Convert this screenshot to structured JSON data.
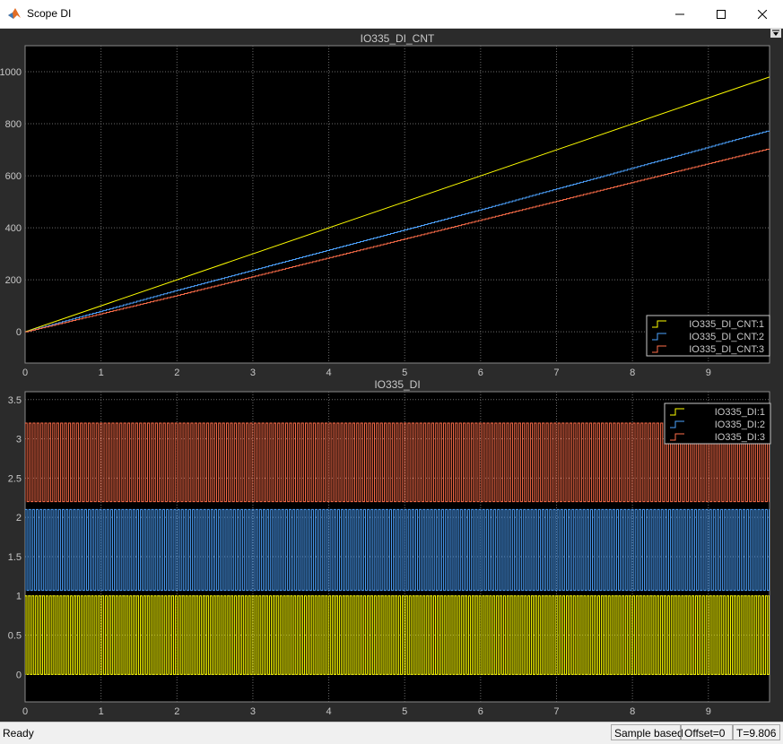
{
  "window": {
    "title": "Scope DI",
    "app_icon": "matlab-icon",
    "controls": [
      "minimize-icon",
      "maximize-icon",
      "close-icon"
    ]
  },
  "colors": {
    "scope_background": "#2b2b2b",
    "axes_background": "#000000",
    "grid": "#6a6a6a",
    "axis_text": "#c8c8c8",
    "series1": "#ffff00",
    "series2": "#4da3ff",
    "series3": "#ff6e4a"
  },
  "status": {
    "ready": "Ready",
    "mode": "Sample based",
    "offset": "Offset=0",
    "time": "T=9.806"
  },
  "chart_data": [
    {
      "type": "line",
      "title": "IO335_DI_CNT",
      "xlabel": "",
      "ylabel": "",
      "xlim": [
        0,
        9.806
      ],
      "ylim": [
        -120,
        1100
      ],
      "xticks": [
        0,
        1,
        2,
        3,
        4,
        5,
        6,
        7,
        8,
        9
      ],
      "yticks": [
        0,
        200,
        400,
        600,
        800,
        1000
      ],
      "grid": true,
      "legend_position": "bottom-right",
      "series": [
        {
          "name": "IO335_DI_CNT:1",
          "color": "#ffff00",
          "x": [
            0,
            9.806
          ],
          "y": [
            0,
            980
          ]
        },
        {
          "name": "IO335_DI_CNT:2",
          "color": "#4da3ff",
          "x": [
            0,
            2,
            4,
            6,
            8,
            9.806
          ],
          "y": [
            0,
            160,
            315,
            470,
            630,
            775
          ]
        },
        {
          "name": "IO335_DI_CNT:3",
          "color": "#ff6e4a",
          "x": [
            0,
            2,
            4,
            6,
            8,
            9.806
          ],
          "y": [
            0,
            140,
            285,
            430,
            575,
            705
          ]
        }
      ]
    },
    {
      "type": "line",
      "title": "IO335_DI",
      "xlabel": "",
      "ylabel": "",
      "xlim": [
        0,
        9.806
      ],
      "ylim": [
        -0.35,
        3.6
      ],
      "xticks": [
        0,
        1,
        2,
        3,
        4,
        5,
        6,
        7,
        8,
        9
      ],
      "yticks": [
        0,
        0.5,
        1,
        1.5,
        2,
        2.5,
        3,
        3.5
      ],
      "grid": true,
      "legend_position": "top-right",
      "series": [
        {
          "name": "IO335_DI:1",
          "color": "#ffff00",
          "low": 0,
          "high": 1,
          "description": "rapid square wave toggling between 0 and 1"
        },
        {
          "name": "IO335_DI:2",
          "color": "#4da3ff",
          "low": 1.07,
          "high": 2.1,
          "description": "rapid square wave toggling between 1.07 and 2.1"
        },
        {
          "name": "IO335_DI:3",
          "color": "#ff6e4a",
          "low": 2.2,
          "high": 3.2,
          "description": "rapid square wave toggling between 2.2 and 3.2"
        }
      ]
    }
  ]
}
